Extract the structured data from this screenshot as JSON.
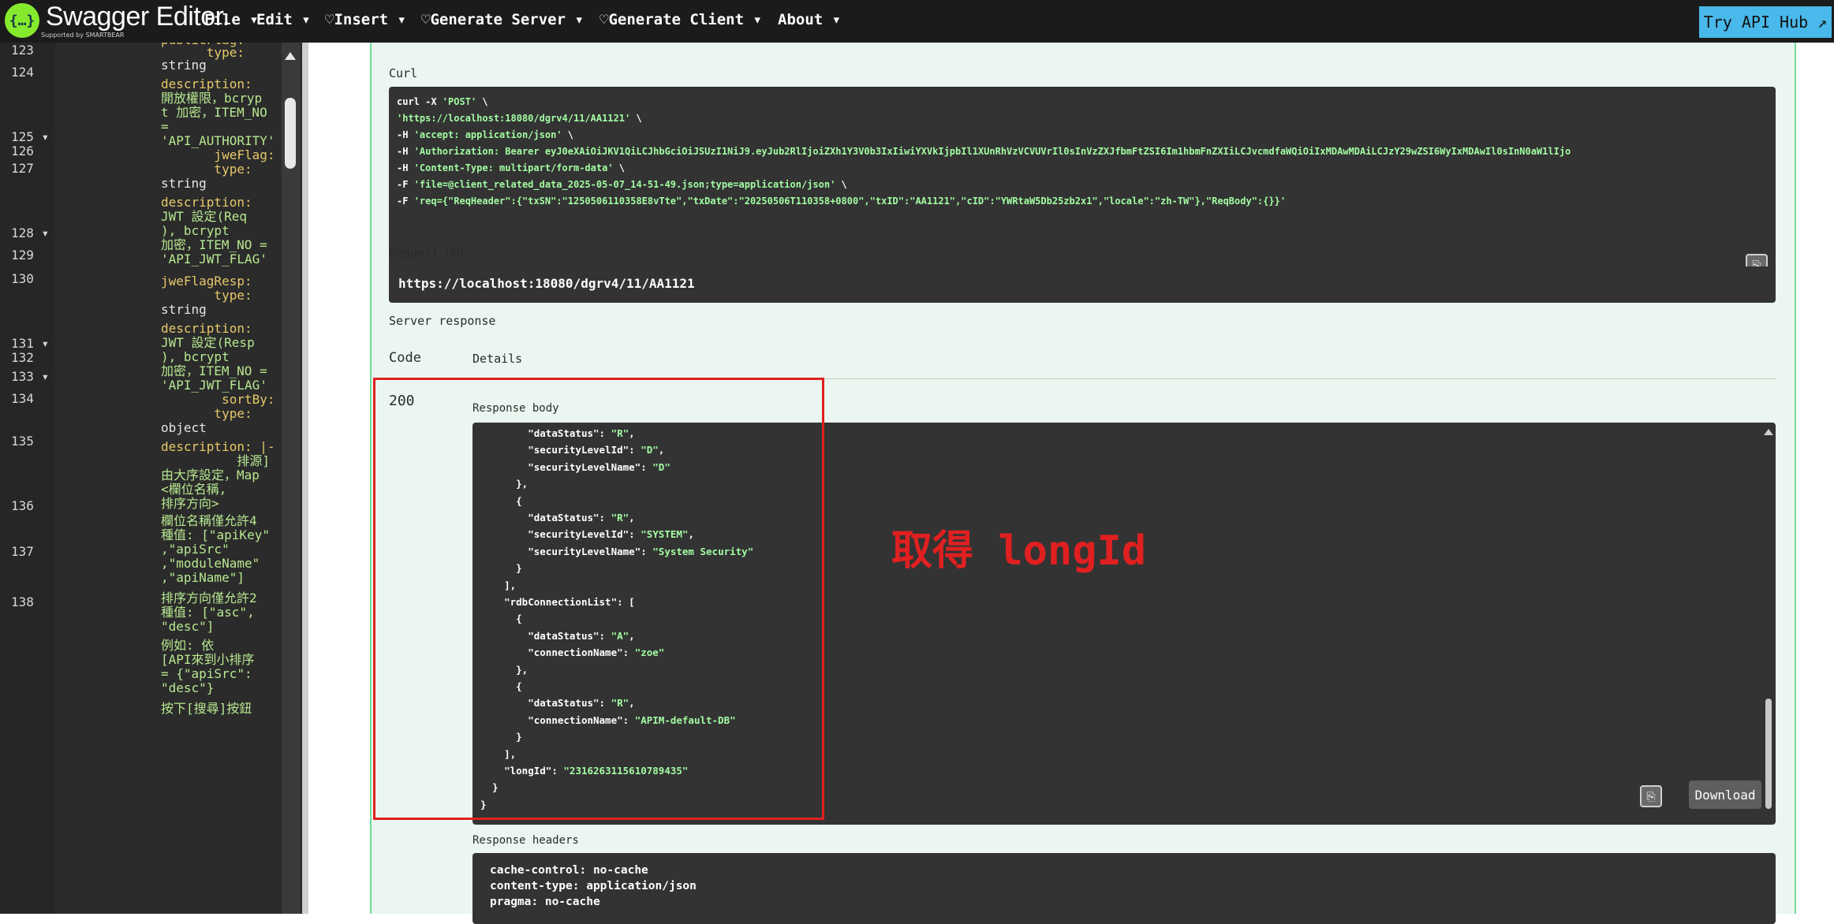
{
  "topbar": {
    "logo_glyph": "{…}",
    "brand": "Swagger Editor.",
    "brand_sub": "Supported by SMARTBEAR",
    "menus": [
      "File ▾",
      "Edit ▾",
      "♡Insert ▾",
      "♡Generate Server ▾",
      "♡Generate Client ▾",
      "About ▾"
    ],
    "try_hub": "Try API Hub ↗"
  },
  "editor": {
    "line_numbers": [
      "123",
      "124",
      "125 ▾",
      "126",
      "127",
      "128 ▾",
      "129",
      "130",
      "131 ▾",
      "132",
      "133 ▾",
      "134",
      "135",
      "136",
      "137",
      "138"
    ],
    "lines": [
      {
        "text": "publicFlag:",
        "cls": "key"
      },
      {
        "text": "      type:",
        "cls": "key"
      },
      {
        "text": "string",
        "cls": ""
      },
      {
        "text": "description:",
        "cls": "desc"
      },
      {
        "text": "開放權限，bcryp",
        "cls": "str"
      },
      {
        "text": "t 加密，ITEM_NO",
        "cls": "str"
      },
      {
        "text": "=",
        "cls": "str"
      },
      {
        "text": "'API_AUTHORITY'",
        "cls": "str"
      },
      {
        "text": "       jweFlag:",
        "cls": "key"
      },
      {
        "text": "       type:",
        "cls": "key"
      },
      {
        "text": "string",
        "cls": ""
      },
      {
        "text": "description:",
        "cls": "desc"
      },
      {
        "text": "JWT 設定(Req",
        "cls": "str"
      },
      {
        "text": "), bcrypt",
        "cls": "str"
      },
      {
        "text": "加密，ITEM_NO =",
        "cls": "str"
      },
      {
        "text": "'API_JWT_FLAG'",
        "cls": "str"
      },
      {
        "text": "jweFlagResp:",
        "cls": "key"
      },
      {
        "text": "       type:",
        "cls": "key"
      },
      {
        "text": "string",
        "cls": ""
      },
      {
        "text": "description:",
        "cls": "desc"
      },
      {
        "text": "JWT 設定(Resp",
        "cls": "str"
      },
      {
        "text": "), bcrypt",
        "cls": "str"
      },
      {
        "text": "加密，ITEM_NO =",
        "cls": "str"
      },
      {
        "text": "'API_JWT_FLAG'",
        "cls": "str"
      },
      {
        "text": "        sortBy:",
        "cls": "key"
      },
      {
        "text": "       type:",
        "cls": "key"
      },
      {
        "text": "object",
        "cls": ""
      },
      {
        "text": "description: |-",
        "cls": "desc"
      },
      {
        "text": "          排源]",
        "cls": "str"
      },
      {
        "text": "由大序設定，Map",
        "cls": "str"
      },
      {
        "text": "<欄位名稱,",
        "cls": "str"
      },
      {
        "text": "排序方向>",
        "cls": "str"
      },
      {
        "text": "欄位名稱僅允許4",
        "cls": "str"
      },
      {
        "text": "種值: [\"apiKey\"",
        "cls": "str"
      },
      {
        "text": ",\"apiSrc\"",
        "cls": "str"
      },
      {
        "text": ",\"moduleName\"",
        "cls": "str"
      },
      {
        "text": ",\"apiName\"]",
        "cls": "str"
      },
      {
        "text": "排序方向僅允許2",
        "cls": "str"
      },
      {
        "text": "種值: [\"asc\",",
        "cls": "str"
      },
      {
        "text": "\"desc\"]",
        "cls": "str"
      },
      {
        "text": "例如: 依",
        "cls": "str"
      },
      {
        "text": "[API來到小排序",
        "cls": "str"
      },
      {
        "text": "= {\"apiSrc\":",
        "cls": "str"
      },
      {
        "text": "\"desc\"}",
        "cls": "str"
      },
      {
        "text": "按下[搜尋]按鈕",
        "cls": "str"
      }
    ]
  },
  "response_panel": {
    "curl_label": "Curl",
    "curl_lines": [
      [
        "curl -X ",
        "'POST'",
        " \\"
      ],
      [
        "  ",
        "'https://localhost:18080/dgrv4/11/AA1121'",
        " \\"
      ],
      [
        "  -H ",
        "'accept: application/json'",
        " \\"
      ],
      [
        "  -H ",
        "'Authorization: Bearer eyJ0eXAiOiJKV1QiLCJhbGciOiJSUzI1NiJ9.eyJub2RlIjoiZXh1Y3V0b3IxIiwiYXVkIjpbIl1XUnRhVzVCVUVrIl0sInVzZXJfbmFtZSI6Im1hbmFnZXIiLCJvcmdfaWQiOiIxMDAwMDAiLCJzY29wZSI6WyIxMDAwIl0sInN0aW1lIjo",
        ""
      ],
      [
        "  -H ",
        "'Content-Type: multipart/form-data'",
        " \\"
      ],
      [
        "  -F ",
        "'file=@client_related_data_2025-05-07_14-51-49.json;type=application/json'",
        " \\"
      ],
      [
        "  -F ",
        "'req={\"ReqHeader\":{\"txSN\":\"1250506110358E8vTte\",\"txDate\":\"20250506T110358+0800\",\"txID\":\"AA1121\",\"cID\":\"YWRtaW5Db25zb2x1\",\"locale\":\"zh-TW\"},\"ReqBody\":{}}'",
        ""
      ]
    ],
    "request_url_label": "Request URL",
    "request_url": "https://localhost:18080/dgrv4/11/AA1121",
    "server_response_label": "Server response",
    "code_header": "Code",
    "details_header": "Details",
    "status_code": "200",
    "response_body_label": "Response body",
    "json_lines": [
      [
        "        ",
        "\"dataStatus\"",
        ": ",
        "\"R\"",
        ","
      ],
      [
        "        ",
        "\"securityLevelId\"",
        ": ",
        "\"D\"",
        ","
      ],
      [
        "        ",
        "\"securityLevelName\"",
        ": ",
        "\"D\"",
        ""
      ],
      [
        "      },",
        "",
        "",
        "",
        ""
      ],
      [
        "      {",
        "",
        "",
        "",
        ""
      ],
      [
        "        ",
        "\"dataStatus\"",
        ": ",
        "\"R\"",
        ","
      ],
      [
        "        ",
        "\"securityLevelId\"",
        ": ",
        "\"SYSTEM\"",
        ","
      ],
      [
        "        ",
        "\"securityLevelName\"",
        ": ",
        "\"System Security\"",
        ""
      ],
      [
        "      }",
        "",
        "",
        "",
        ""
      ],
      [
        "    ],",
        "",
        "",
        "",
        ""
      ],
      [
        "    ",
        "\"rdbConnectionList\"",
        ": [",
        "",
        ""
      ],
      [
        "      {",
        "",
        "",
        "",
        ""
      ],
      [
        "        ",
        "\"dataStatus\"",
        ": ",
        "\"A\"",
        ","
      ],
      [
        "        ",
        "\"connectionName\"",
        ": ",
        "\"zoe\"",
        ""
      ],
      [
        "      },",
        "",
        "",
        "",
        ""
      ],
      [
        "      {",
        "",
        "",
        "",
        ""
      ],
      [
        "        ",
        "\"dataStatus\"",
        ": ",
        "\"R\"",
        ","
      ],
      [
        "        ",
        "\"connectionName\"",
        ": ",
        "\"APIM-default-DB\"",
        ""
      ],
      [
        "      }",
        "",
        "",
        "",
        ""
      ],
      [
        "    ],",
        "",
        "",
        "",
        ""
      ],
      [
        "    ",
        "\"longId\"",
        ": ",
        "\"2316263115610789435\"",
        ""
      ],
      [
        "  }",
        "",
        "",
        "",
        ""
      ],
      [
        "}",
        "",
        "",
        "",
        ""
      ]
    ],
    "download_label": "Download",
    "response_headers_label": "Response headers",
    "headers": [
      "cache-control: no-cache",
      "content-type: application/json",
      "pragma: no-cache"
    ],
    "annotation": "取得 longId",
    "copy_icon": "⎘"
  },
  "colors": {
    "highlight": "#e02020",
    "op_bg": "#eaf6ef",
    "op_border": "#6fdc9a",
    "json_string": "#a2fca2",
    "try_hub": "#49b8ea",
    "logo": "#85ea2d"
  }
}
